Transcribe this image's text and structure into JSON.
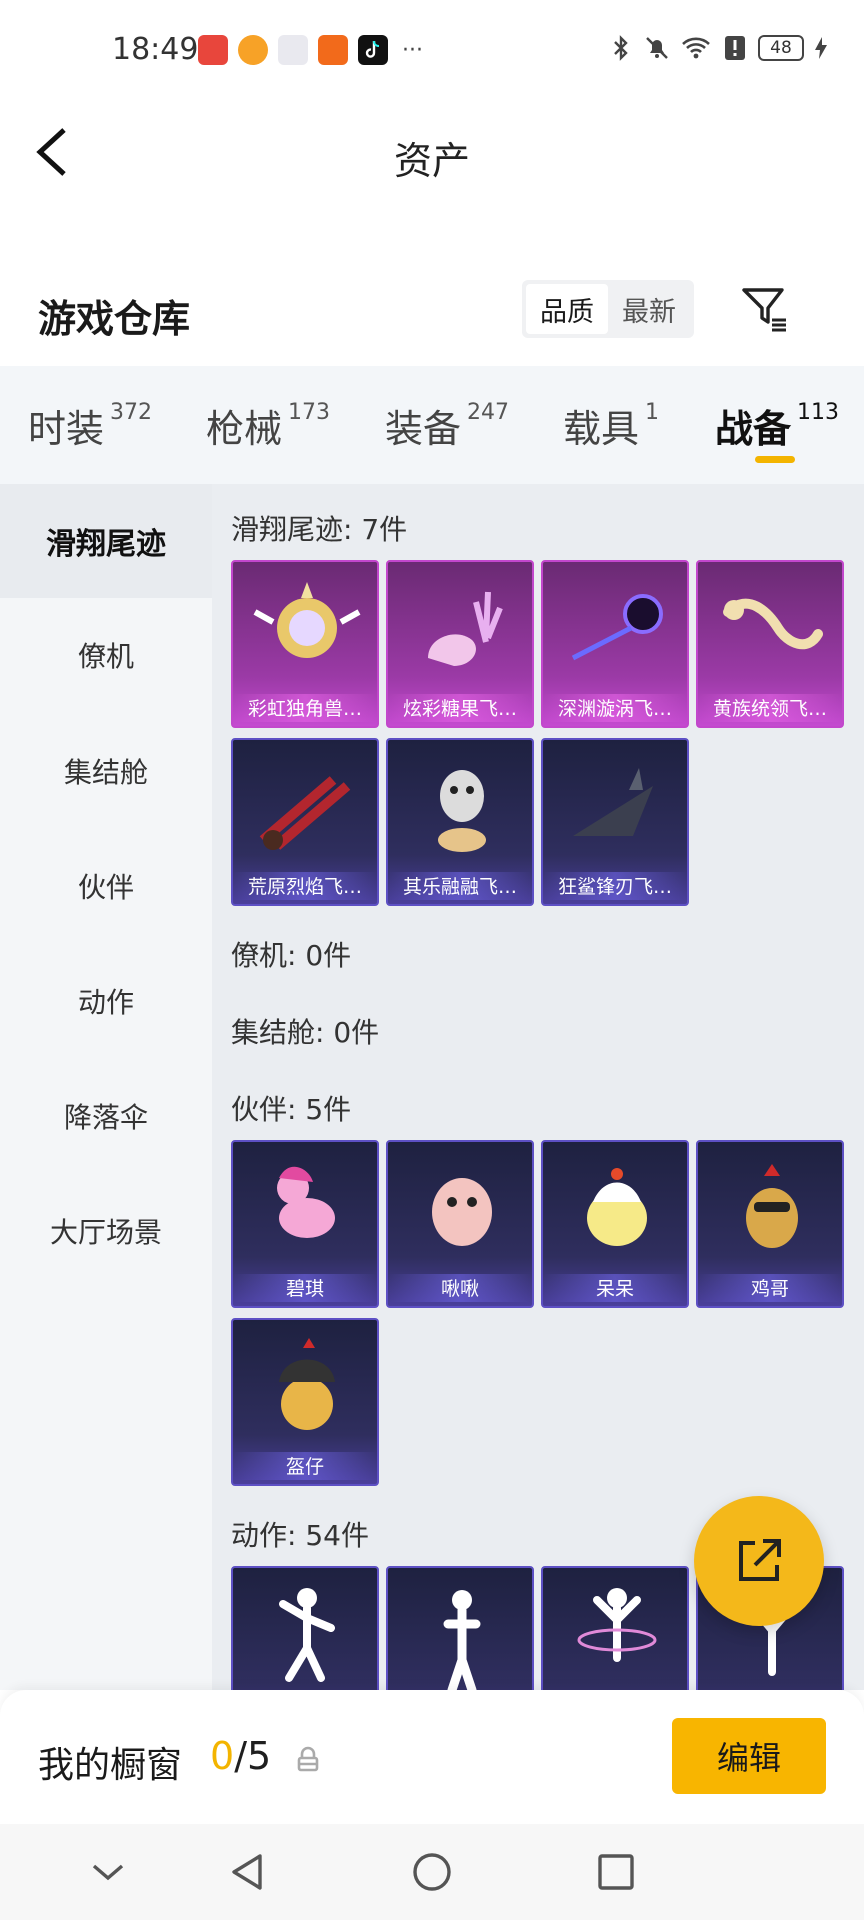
{
  "status_bar": {
    "time": "18:49",
    "battery": "48",
    "more": "···"
  },
  "header": {
    "title": "资产"
  },
  "warehouse": {
    "title": "游戏仓库",
    "sort_options": [
      "品质",
      "最新"
    ]
  },
  "tabs": [
    {
      "label": "时装",
      "count": "372"
    },
    {
      "label": "枪械",
      "count": "173"
    },
    {
      "label": "装备",
      "count": "247"
    },
    {
      "label": "载具",
      "count": "1"
    },
    {
      "label": "战备",
      "count": "113"
    }
  ],
  "sidebar": {
    "items": [
      "滑翔尾迹",
      "僚机",
      "集结舱",
      "伙伴",
      "动作",
      "降落伞",
      "大厅场景"
    ]
  },
  "sections": {
    "glide": {
      "heading": "滑翔尾迹: 7件",
      "items": [
        "彩虹独角兽…",
        "炫彩糖果飞…",
        "深渊漩涡飞…",
        "黄族统领飞…",
        "荒原烈焰飞…",
        "其乐融融飞…",
        "狂鲨锋刃飞…"
      ]
    },
    "wingman": {
      "heading": "僚机: 0件"
    },
    "pod": {
      "heading": "集结舱: 0件"
    },
    "partner": {
      "heading": "伙伴: 5件",
      "items": [
        "碧琪",
        "啾啾",
        "呆呆",
        "鸡哥",
        "盔仔"
      ]
    },
    "emote": {
      "heading": "动作: 54件"
    }
  },
  "showcase": {
    "title": "我的橱窗",
    "current": "0",
    "total": "/5",
    "edit_label": "编辑"
  },
  "colors": {
    "accent": "#f3b400",
    "epic": "#c247cc",
    "rare": "#5d50c4"
  }
}
